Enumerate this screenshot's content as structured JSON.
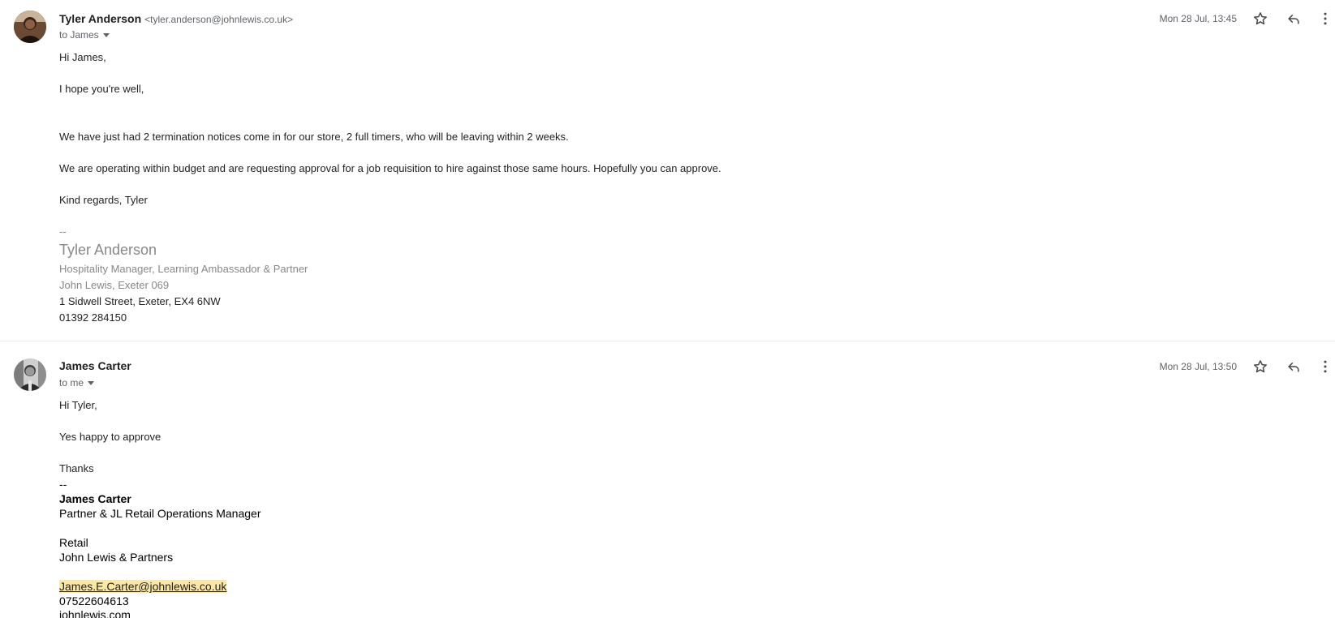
{
  "messages": [
    {
      "sender_name": "Tyler Anderson",
      "sender_email": "<tyler.anderson@johnlewis.co.uk>",
      "recipient": "to James",
      "date": "Mon 28 Jul, 13:45",
      "avatar_icon": "person-photo",
      "body": {
        "greeting": "Hi James,",
        "line1": "I hope you're well,",
        "line2": "We have just had 2 termination notices come in for our store, 2 full timers, who will be leaving within 2 weeks.",
        "line3": "We are operating within budget and are requesting approval for a job requisition to hire against those same hours. Hopefully you can approve.",
        "closing": "Kind regards, Tyler"
      },
      "signature": {
        "dashes": "--",
        "name": "Tyler Anderson",
        "title": "Hospitality Manager, Learning Ambassador & Partner",
        "store": "John Lewis, Exeter 069",
        "address": "1 Sidwell Street, Exeter, EX4 6NW",
        "phone": "01392 284150"
      }
    },
    {
      "sender_name": "James Carter",
      "recipient": "to me",
      "date": "Mon 28 Jul, 13:50",
      "avatar_icon": "person-photo",
      "body": {
        "greeting": "Hi Tyler,",
        "line1": "Yes happy to approve",
        "closing": "Thanks"
      },
      "signature": {
        "dashes": "--",
        "name": "James Carter",
        "title": "Partner & JL Retail Operations Manager",
        "department": "Retail",
        "company": "John Lewis & Partners",
        "email": "James.E.Carter@johnlewis.co.uk",
        "phone": "07522604613",
        "website": "johnlewis.com"
      }
    }
  ],
  "icons": {
    "star": "star-outline-icon",
    "reply": "reply-icon",
    "more": "more-vertical-icon",
    "caret": "caret-down-icon"
  },
  "colors": {
    "link_highlight": "#fce8a6",
    "divider": "#e8eaed",
    "signature_grey": "#888888"
  }
}
